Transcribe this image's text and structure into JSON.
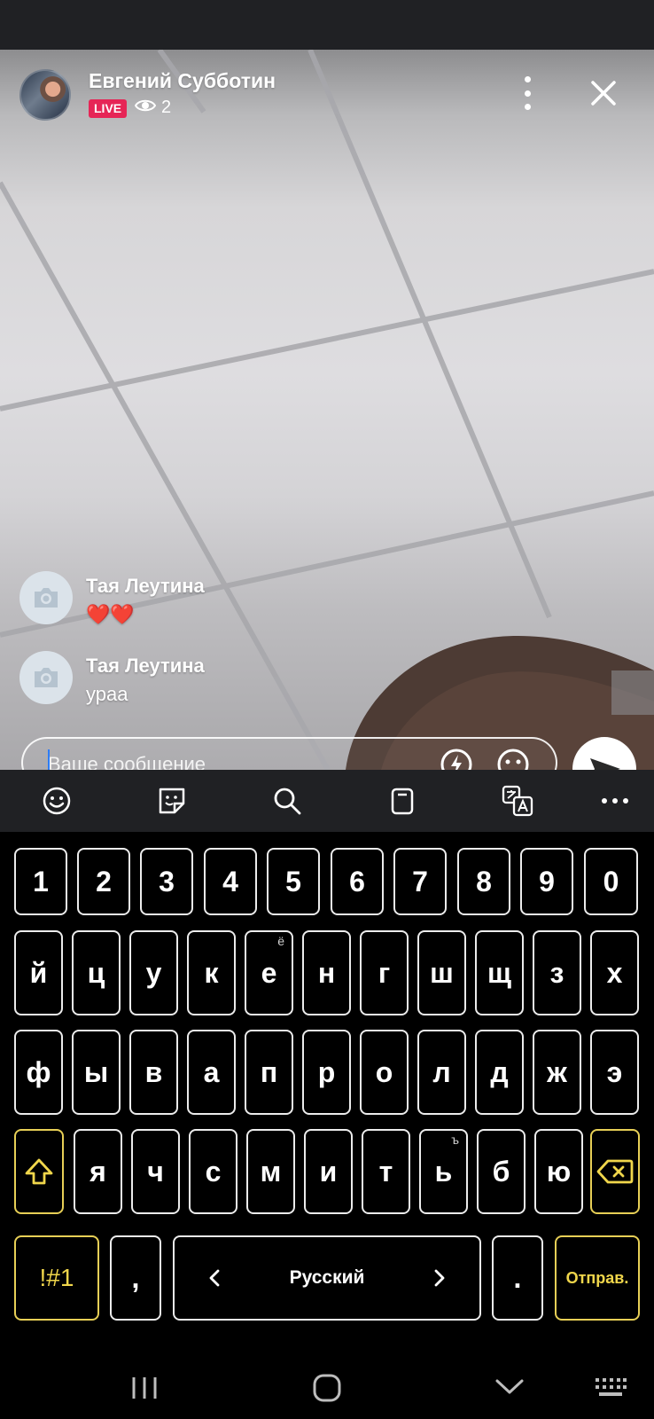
{
  "live": {
    "host_name": "Евгений Субботин",
    "badge": "LIVE",
    "viewer_count": "2",
    "comments": [
      {
        "author": "Тая Леутина",
        "text": "❤️❤️"
      },
      {
        "author": "Тая Леутина",
        "text": "ураа"
      }
    ],
    "input_placeholder": "Ваше сообщение"
  },
  "keyboard": {
    "toolbar_icons": [
      "emoji-icon",
      "sticker-icon",
      "search-icon",
      "clipboard-icon",
      "translate-icon",
      "more-icon"
    ],
    "row_numbers": [
      "1",
      "2",
      "3",
      "4",
      "5",
      "6",
      "7",
      "8",
      "9",
      "0"
    ],
    "row1": [
      "й",
      "ц",
      "у",
      "к",
      "е",
      "н",
      "г",
      "ш",
      "щ",
      "з",
      "х"
    ],
    "row1_hint_e": "ё",
    "row2": [
      "ф",
      "ы",
      "в",
      "а",
      "п",
      "р",
      "о",
      "л",
      "д",
      "ж",
      "э"
    ],
    "row3": [
      "я",
      "ч",
      "с",
      "м",
      "и",
      "т",
      "ь",
      "б",
      "ю"
    ],
    "row3_hint_soft": "ъ",
    "symbols_key": "!#1",
    "comma_key": ",",
    "space_label": "Русский",
    "period_key": ".",
    "send_key": "Отправ."
  },
  "colors": {
    "live_badge": "#e62556",
    "key_border": "#ececec",
    "accent_key": "#e7cf56",
    "toolbar_bg": "#202124"
  }
}
